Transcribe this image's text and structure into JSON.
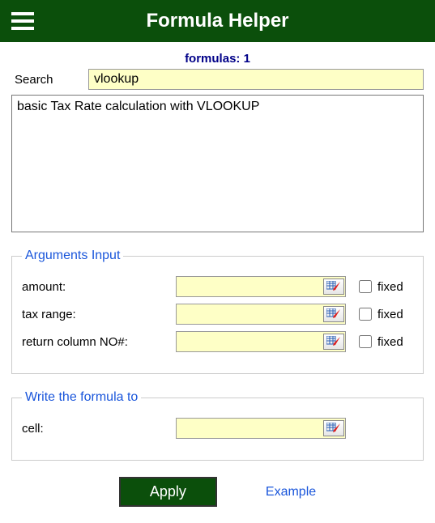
{
  "header": {
    "title": "Formula Helper"
  },
  "formulas_count_label": "formulas: 1",
  "search": {
    "label": "Search",
    "value": "vlookup"
  },
  "results": [
    "basic Tax Rate calculation with VLOOKUP"
  ],
  "args_section": {
    "legend": "Arguments Input",
    "rows": [
      {
        "label": "amount:",
        "value": "",
        "fixed_label": "fixed",
        "fixed": false
      },
      {
        "label": "tax range:",
        "value": "",
        "fixed_label": "fixed",
        "fixed": false
      },
      {
        "label": "return column NO#:",
        "value": "",
        "fixed_label": "fixed",
        "fixed": false
      }
    ]
  },
  "write_section": {
    "legend": "Write the formula to",
    "label": "cell:",
    "value": ""
  },
  "buttons": {
    "apply": "Apply",
    "example": "Example"
  }
}
